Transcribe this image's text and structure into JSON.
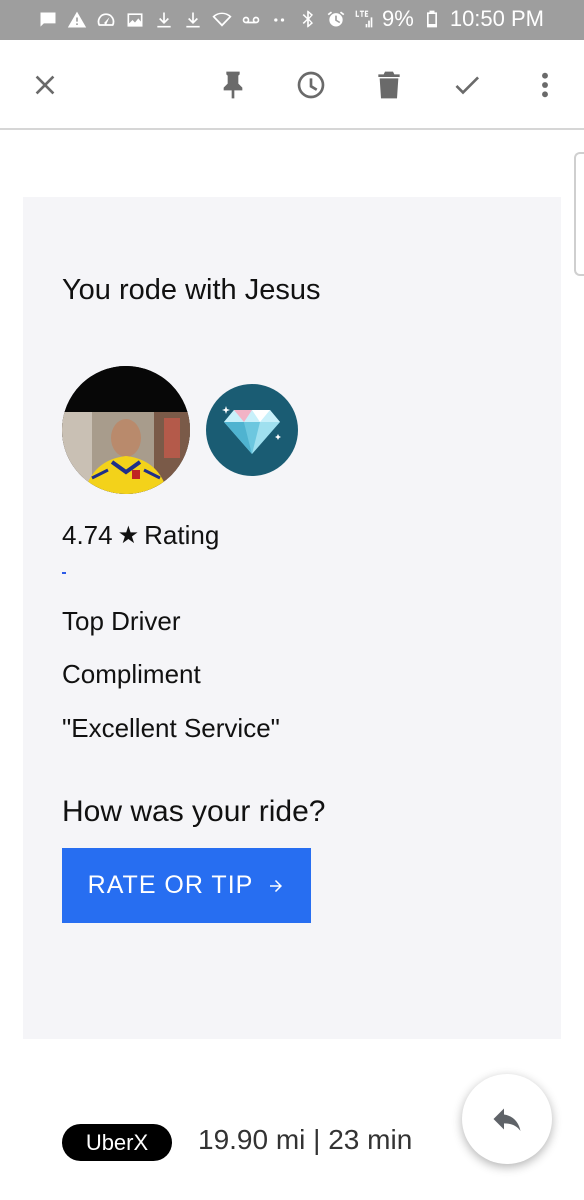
{
  "status_bar": {
    "battery": "9%",
    "time": "10:50 PM",
    "network": "LTE",
    "left_icons": [
      "message-icon",
      "warning-icon",
      "speed-icon",
      "image-icon",
      "download-icon",
      "download-icon",
      "wifi-icon",
      "voicemail-icon",
      "more-dots-icon"
    ],
    "right_icons": [
      "bluetooth-icon",
      "alarm-icon",
      "lte-signal-icon",
      "battery-icon"
    ]
  },
  "toolbar": {
    "actions": [
      "close-icon",
      "pin-icon",
      "snooze-icon",
      "delete-icon",
      "done-icon",
      "more-vert-icon"
    ]
  },
  "email": {
    "title": "You rode with Jesus",
    "rating_value": "4.74",
    "rating_star": "★",
    "rating_label": "Rating",
    "badge_icon": "diamond-icon",
    "compliments": [
      "Top Driver",
      "Compliment",
      "\"Excellent Service\""
    ],
    "question": "How was your ride?",
    "button_label": "RATE OR TIP",
    "button_color": "#276ef1",
    "product": "UberX",
    "trip_stats": "19.90 mi | 23 min"
  },
  "fab": {
    "icon": "reply-icon"
  },
  "colors": {
    "status_bar": "#9e9e9e",
    "card_background": "#f5f5f8",
    "badge_background": "#1a5c73"
  }
}
